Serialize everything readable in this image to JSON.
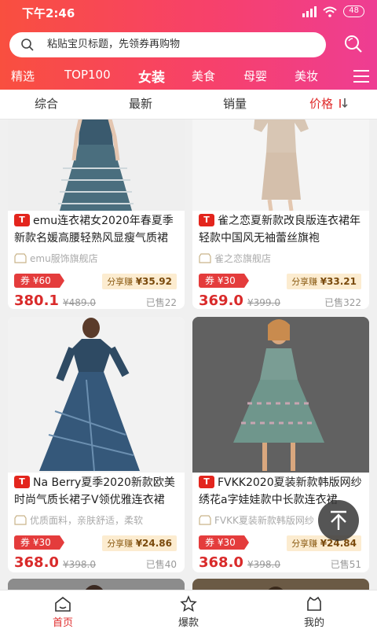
{
  "status_bar": {
    "time": "下午2:46",
    "battery": "48"
  },
  "search": {
    "placeholder": "粘贴宝贝标题，先领券再购物"
  },
  "categories": [
    "精选",
    "TOP100",
    "女装",
    "美食",
    "母婴",
    "美妆"
  ],
  "sort_tabs": [
    "综合",
    "最新",
    "销量",
    "价格"
  ],
  "products": [
    {
      "title": "emu连衣裙女2020年春夏季新款名媛高腰轻熟风显瘦气质裙",
      "shop": "emu服饰旗舰店",
      "coupon": "券 ¥60",
      "share_label": "分享赚",
      "share_amount": "¥35.92",
      "price": "380.1",
      "original_price": "¥489.0",
      "sold": "已售22"
    },
    {
      "title": "雀之恋夏新款改良版连衣裙年轻款中国风无袖蕾丝旗袍",
      "shop": "雀之恋旗舰店",
      "coupon": "券 ¥30",
      "share_label": "分享赚",
      "share_amount": "¥33.21",
      "price": "369.0",
      "original_price": "¥399.0",
      "sold": "已售322"
    },
    {
      "title": "Na Berry夏季2020新款欧美时尚气质长裙子V领优雅连衣裙",
      "shop": "优质面料，亲肤舒适，柔软",
      "coupon": "券 ¥30",
      "share_label": "分享赚",
      "share_amount": "¥24.86",
      "price": "368.0",
      "original_price": "¥398.0",
      "sold": "已售40"
    },
    {
      "title": "FVKK2020夏装新款韩版网纱绣花a字娃娃款中长款连衣裙",
      "shop": "FVKK夏装新款韩版网纱",
      "coupon": "券 ¥30",
      "share_label": "分享赚",
      "share_amount": "¥24.84",
      "price": "368.0",
      "original_price": "¥398.0",
      "sold": "已售51"
    }
  ],
  "bottom_tabs": [
    "首页",
    "爆款",
    "我的"
  ],
  "colors": {
    "accent": "#e02d2d",
    "header_start": "#f94f3f",
    "header_end": "#ee3d93",
    "share_bg": "#fcecd0"
  }
}
